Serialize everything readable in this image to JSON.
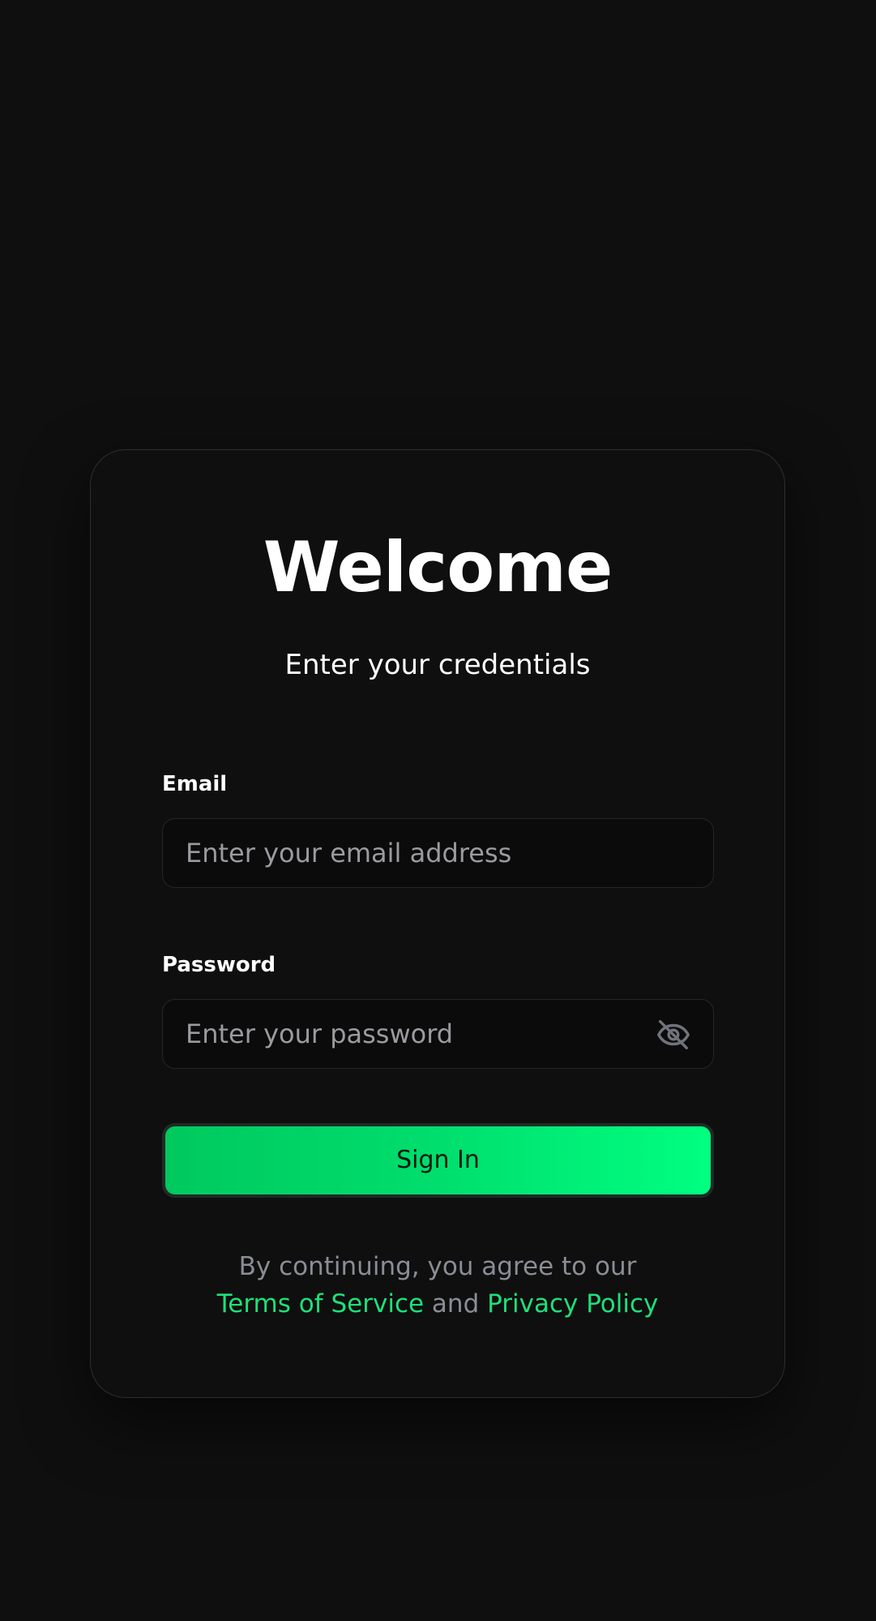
{
  "card": {
    "title": "Welcome",
    "subtitle": "Enter your credentials"
  },
  "email": {
    "label": "Email",
    "value": "",
    "placeholder": "Enter your email address"
  },
  "password": {
    "label": "Password",
    "value": "",
    "placeholder": "Enter your password",
    "toggle_icon": "eye-off-icon"
  },
  "signin": {
    "label": "Sign In"
  },
  "legal": {
    "line1": "By continuing, you agree to our",
    "terms": "Terms of Service",
    "and": "and",
    "privacy": "Privacy Policy"
  },
  "colors": {
    "background": "#0f0f0f",
    "accent": "#00e676",
    "link": "#1ee07a",
    "muted_text": "#8a8d95"
  }
}
